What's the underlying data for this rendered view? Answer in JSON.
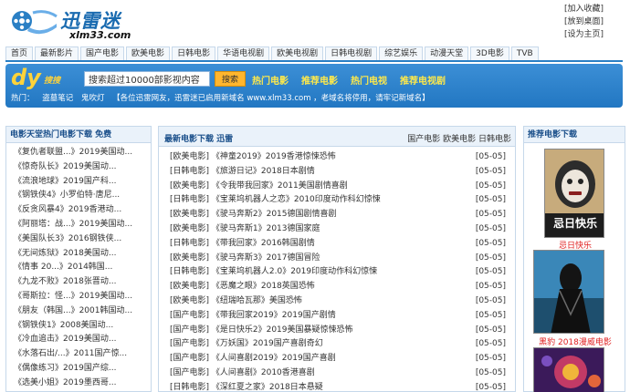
{
  "header": {
    "logo_cn": "迅雷迷",
    "logo_en": "xlm33.com",
    "top_links": [
      "[加入收藏]",
      "[放到桌面]",
      "[设为主页]"
    ]
  },
  "nav": {
    "tabs": [
      "首页",
      "最新影片",
      "国产电影",
      "欧美电影",
      "日韩电影",
      "华语电视剧",
      "欧美电视剧",
      "日韩电视剧",
      "综艺娱乐",
      "动漫天堂",
      "3D电影",
      "TVB"
    ]
  },
  "search": {
    "dy": "dy",
    "label": "搜搜",
    "value": "搜索超过10000部影视内容",
    "button": "搜索",
    "hot_links": [
      "热门电影",
      "推荐电影",
      "热门电视",
      "推荐电视剧"
    ],
    "notice": [
      "热门：",
      "盗墓笔记",
      "鬼吹灯",
      "【各位迅雷网友，迅雷迷已启用新域名 www.xlm33.com ，老域名将停用，请牢记新域名】"
    ]
  },
  "left_panel": {
    "title": "电影天堂热门电影下载 免费",
    "items": [
      "《复仇者联盟...》2019美国动...",
      "《惊奇队长》2019美国动...",
      "《流浪地球》2019国产科...",
      "《钢铁侠4》小罗伯特·唐尼...",
      "《反贪风暴4》2019香港动...",
      "《阿丽塔：战...》2019美国动...",
      "《美国队长3》2016钢铁侠...",
      "《无间炼狱》2018美国动...",
      "《情事 20...》2014韩国...",
      "《九龙不败》2018张晋动...",
      "《哥斯拉：怪...》2019美国动...",
      "《朋友（韩国...》2001韩国动...",
      "《钢铁侠1》2008美国动...",
      "《冷血追击》2019美国动...",
      "《水落石出/...》2011国产惊...",
      "《偶像练习》2019国产综...",
      "《选美小姐》2019墨西哥..."
    ]
  },
  "center_panel": {
    "title": "最新电影下载 迅雷",
    "categories": "国产电影 欧美电影 日韩电影",
    "items": [
      {
        "text": "[欧美电影] 《神童2019》2019香港惊悚恐怖",
        "date": "[05-05]"
      },
      {
        "text": "[日韩电影] 《旅游日记》2018日本剧情",
        "date": "[05-05]"
      },
      {
        "text": "[欧美电影] 《令我带我回家》2011美国剧情喜剧",
        "date": "[05-05]"
      },
      {
        "text": "[日韩电影] 《宝莱坞机器人之恋》2010印度动作科幻惊悚",
        "date": "[05-05]"
      },
      {
        "text": "[欧美电影] 《驶马奔斯2》2015德国剧情喜剧",
        "date": "[05-05]"
      },
      {
        "text": "[欧美电影] 《驶马奔斯1》2013德国家庭",
        "date": "[05-05]"
      },
      {
        "text": "[日韩电影] 《带我回家》2016韩国剧情",
        "date": "[05-05]"
      },
      {
        "text": "[欧美电影] 《驶马奔斯3》2017德国冒险",
        "date": "[05-05]"
      },
      {
        "text": "[日韩电影] 《宝莱坞机器人2.0》2019印度动作科幻惊悚",
        "date": "[05-05]"
      },
      {
        "text": "[欧美电影] 《恶魔之眼》2018英国恐怖",
        "date": "[05-05]"
      },
      {
        "text": "[欧美电影] 《纽瑞哈瓦那》美国恐怖",
        "date": "[05-05]"
      },
      {
        "text": "[国产电影] 《带我回家2019》2019国产剧情",
        "date": "[05-05]"
      },
      {
        "text": "[国产电影] 《是日快乐2》2019美国暴疑惊悚恐怖",
        "date": "[05-05]"
      },
      {
        "text": "[国产电影] 《万妖国》2019国产喜剧奇幻",
        "date": "[05-05]"
      },
      {
        "text": "[国产电影] 《人间喜剧2019》2019国产喜剧",
        "date": "[05-05]"
      },
      {
        "text": "[国产电影] 《人间喜剧》2010香港喜剧",
        "date": "[05-05]"
      },
      {
        "text": "[日韩电影] 《深红夏之家》2018日本悬疑",
        "date": "[05-05]"
      }
    ]
  },
  "right_panel": {
    "title": "推荐电影下载",
    "items": [
      {
        "caption": "忌日快乐",
        "poster_text": "忌日快乐"
      },
      {
        "caption": "黑豹 2018漫威电影",
        "poster_text": ""
      },
      {
        "caption": "",
        "poster_text": ""
      }
    ]
  },
  "colors": {
    "brand_blue": "#2277c2",
    "hot_yellow": "#ffe94a",
    "caption_red": "#e02020"
  }
}
